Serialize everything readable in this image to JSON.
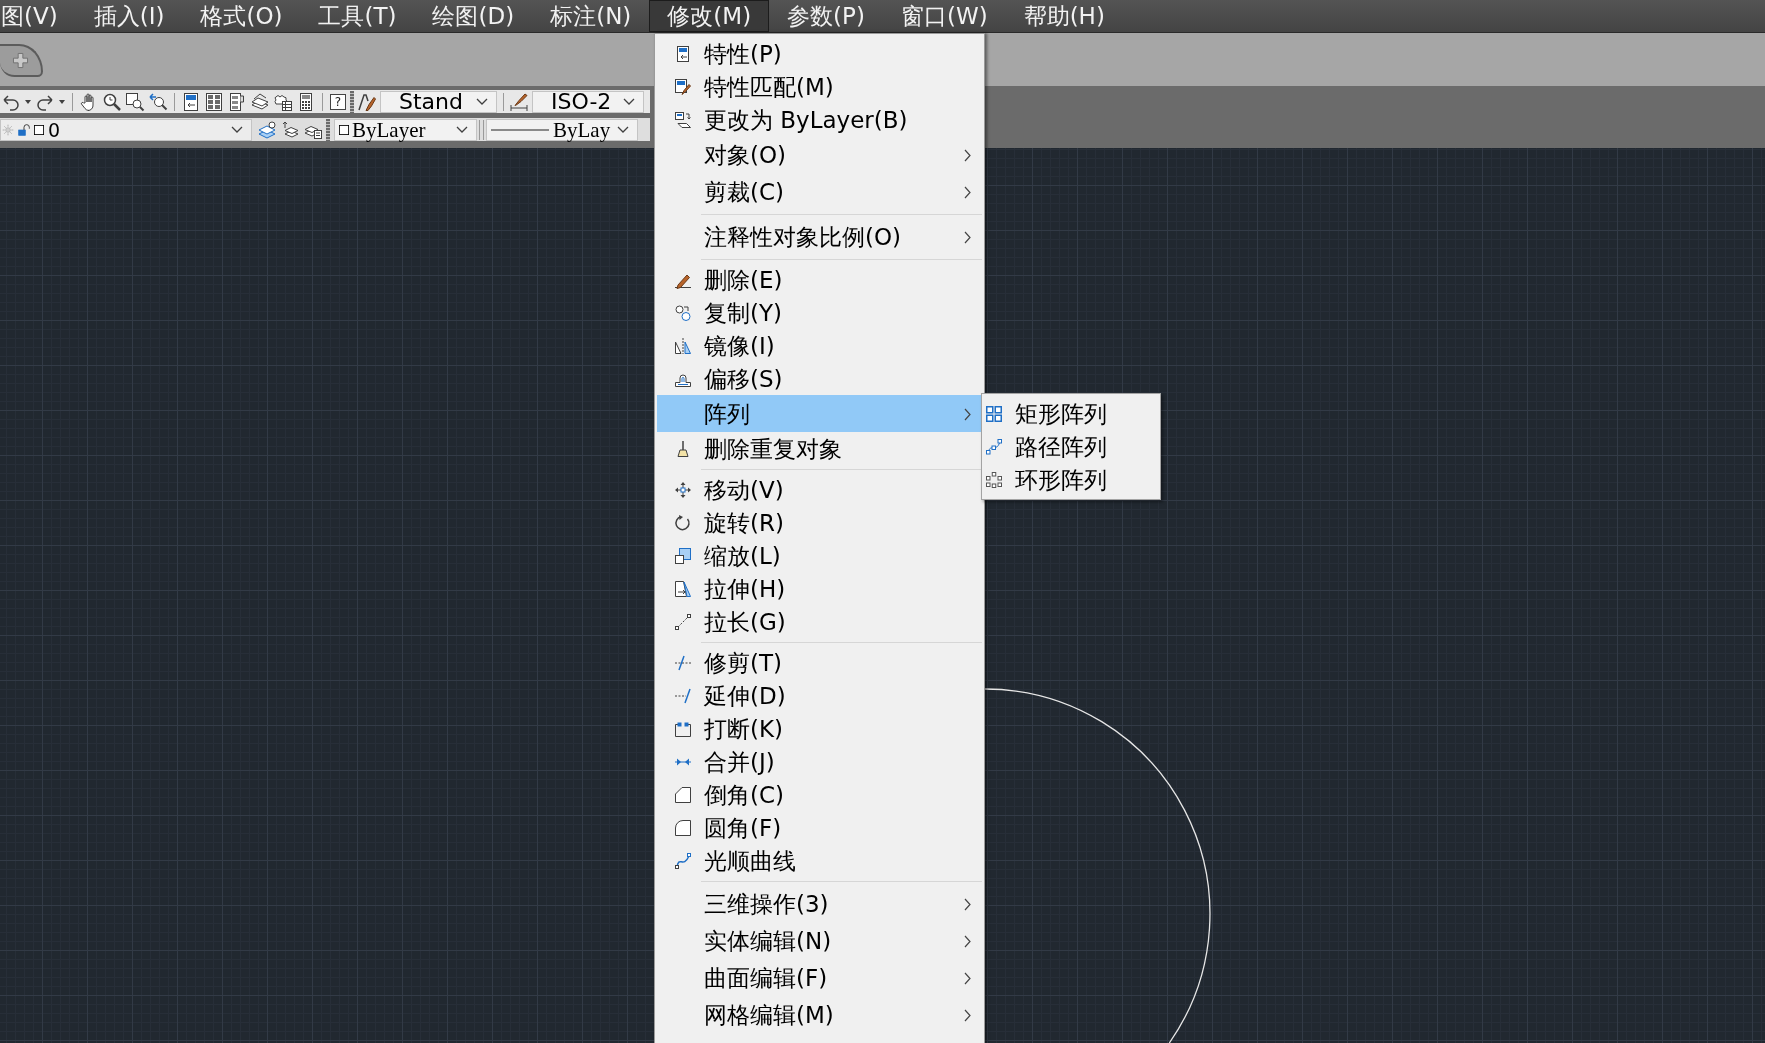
{
  "menu_bar": {
    "items": [
      {
        "label": "图(V)",
        "selected": false
      },
      {
        "label": "插入(I)",
        "selected": false
      },
      {
        "label": "格式(O)",
        "selected": false
      },
      {
        "label": "工具(T)",
        "selected": false
      },
      {
        "label": "绘图(D)",
        "selected": false
      },
      {
        "label": "标注(N)",
        "selected": false
      },
      {
        "label": "修改(M)",
        "selected": true
      },
      {
        "label": "参数(P)",
        "selected": false
      },
      {
        "label": "窗口(W)",
        "selected": false
      },
      {
        "label": "帮助(H)",
        "selected": false
      }
    ]
  },
  "toolbar": {
    "help_button": "?",
    "text_style": "Stand",
    "dimension_style": "ISO-2"
  },
  "layer_toolbar": {
    "layer": "0",
    "color_setting": "ByLayer",
    "linetype": "ByLay"
  },
  "modify_menu": {
    "groups": [
      {
        "items": [
          {
            "kind": "command",
            "label": "特性(P)",
            "selected": false
          },
          {
            "kind": "command",
            "label": "特性匹配(M)",
            "selected": false
          },
          {
            "kind": "command",
            "label": "更改为 ByLayer(B)",
            "selected": false
          },
          {
            "kind": "submenu",
            "label": "对象(O)",
            "selected": false
          },
          {
            "kind": "submenu",
            "label": "剪裁(C)",
            "selected": false
          }
        ]
      },
      {
        "items": [
          {
            "kind": "submenu",
            "label": "注释性对象比例(O)",
            "selected": false
          }
        ]
      },
      {
        "items": [
          {
            "kind": "command",
            "label": "删除(E)",
            "selected": false
          },
          {
            "kind": "command",
            "label": "复制(Y)",
            "selected": false
          },
          {
            "kind": "command",
            "label": "镜像(I)",
            "selected": false
          },
          {
            "kind": "command",
            "label": "偏移(S)",
            "selected": false
          },
          {
            "kind": "submenu",
            "label": "阵列",
            "selected": true
          },
          {
            "kind": "command",
            "label": "删除重复对象",
            "selected": false
          }
        ]
      },
      {
        "items": [
          {
            "kind": "command",
            "label": "移动(V)",
            "selected": false
          },
          {
            "kind": "command",
            "label": "旋转(R)",
            "selected": false
          },
          {
            "kind": "command",
            "label": "缩放(L)",
            "selected": false
          },
          {
            "kind": "command",
            "label": "拉伸(H)",
            "selected": false
          },
          {
            "kind": "command",
            "label": "拉长(G)",
            "selected": false
          }
        ]
      },
      {
        "items": [
          {
            "kind": "command",
            "label": "修剪(T)",
            "selected": false
          },
          {
            "kind": "command",
            "label": "延伸(D)",
            "selected": false
          },
          {
            "kind": "command",
            "label": "打断(K)",
            "selected": false
          },
          {
            "kind": "command",
            "label": "合并(J)",
            "selected": false
          },
          {
            "kind": "command",
            "label": "倒角(C)",
            "selected": false
          },
          {
            "kind": "command",
            "label": "圆角(F)",
            "selected": false
          },
          {
            "kind": "command",
            "label": "光顺曲线",
            "selected": false
          }
        ]
      },
      {
        "items": [
          {
            "kind": "submenu",
            "label": "三维操作(3)",
            "selected": false
          },
          {
            "kind": "submenu",
            "label": "实体编辑(N)",
            "selected": false
          },
          {
            "kind": "submenu",
            "label": "曲面编辑(F)",
            "selected": false
          },
          {
            "kind": "submenu",
            "label": "网格编辑(M)",
            "selected": false
          }
        ]
      }
    ]
  },
  "array_submenu": {
    "items": [
      {
        "label": "矩形阵列",
        "selected": false
      },
      {
        "label": "路径阵列",
        "selected": false
      },
      {
        "label": "环形阵列",
        "selected": false
      }
    ]
  }
}
